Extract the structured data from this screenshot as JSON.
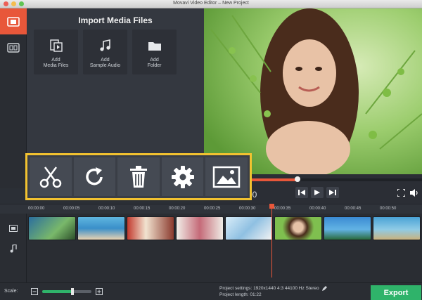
{
  "window": {
    "title": "Movavi Video Editor – New Project"
  },
  "media_panel": {
    "title": "Import Media Files",
    "tiles": [
      {
        "line1": "Add",
        "line2": "Media Files"
      },
      {
        "line1": "Add",
        "line2": "Sample Audio"
      },
      {
        "line1": "Add",
        "line2": "Folder"
      }
    ]
  },
  "player": {
    "time": "00",
    "progress": 0.43
  },
  "ruler_ticks": [
    "00:00:00",
    "00:00:05",
    "00:00:10",
    "00:00:15",
    "00:00:20",
    "00:00:25",
    "00:00:30",
    "00:00:35",
    "00:00:40",
    "00:00:45",
    "00:00:50"
  ],
  "status": {
    "scale_label": "Scale:",
    "scale_value": 0.62,
    "project_settings_label": "Project settings:",
    "project_settings_value": "1920x1440 4:3 44100 Hz Stereo",
    "project_length_label": "Project length:",
    "project_length_value": "01:22",
    "export_label": "Export"
  },
  "colors": {
    "accent": "#e8573a",
    "highlight": "#f2c230",
    "export": "#2fb36a"
  },
  "icons": [
    "video-file-icon",
    "clip-icon",
    "scissors-icon",
    "rotate-icon",
    "trash-icon",
    "gear-icon",
    "image-icon",
    "prev-icon",
    "play-icon",
    "next-icon",
    "fullscreen-icon",
    "volume-icon",
    "pencil-icon",
    "music-note-icon"
  ]
}
